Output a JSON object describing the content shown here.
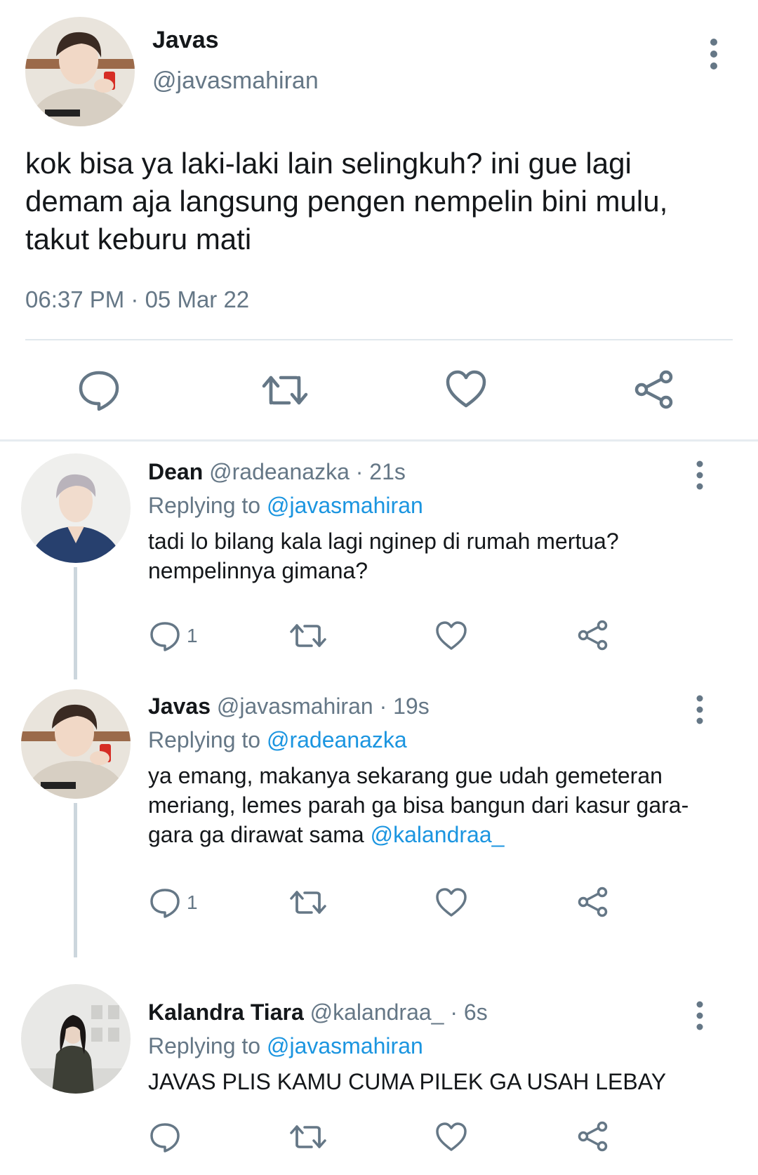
{
  "main_tweet": {
    "name": "Javas",
    "handle": "@javasmahiran",
    "text": "kok bisa ya laki-laki lain selingkuh? ini gue lagi demam aja langsung pengen nempelin bini mulu, takut keburu mati",
    "time": "06:37 PM · 05 Mar 22"
  },
  "replies": [
    {
      "name": "Dean",
      "meta": "@radeanazka · 21s",
      "replying_label": "Replying to",
      "replying_to": "@javasmahiran",
      "text_plain": "tadi lo bilang kala lagi nginep di rumah mertua? nempelinnya gimana?",
      "mention": "",
      "reply_count": "1"
    },
    {
      "name": "Javas",
      "meta": "@javasmahiran · 19s",
      "replying_label": "Replying to",
      "replying_to": "@radeanazka",
      "text_plain": "ya emang, makanya sekarang gue udah gemeteran meriang, lemes parah ga bisa bangun dari kasur gara-gara ga dirawat sama",
      "mention": "@kalandraa_",
      "reply_count": "1"
    },
    {
      "name": "Kalandra Tiara",
      "meta": "@kalandraa_ · 6s",
      "replying_label": "Replying to",
      "replying_to": "@javasmahiran",
      "text_plain": "JAVAS PLIS KAMU CUMA PILEK GA USAH LEBAY",
      "mention": "",
      "reply_count": ""
    }
  ],
  "icons": {
    "reply": "reply-icon",
    "retweet": "retweet-icon",
    "like": "heart-icon",
    "share": "share-icon",
    "more": "more-vertical-icon"
  },
  "colors": {
    "link": "#1b95e0",
    "secondary_text": "#657786",
    "primary_text": "#14171a",
    "divider": "#e1e8ed",
    "thread_line": "#ccd6dd"
  }
}
